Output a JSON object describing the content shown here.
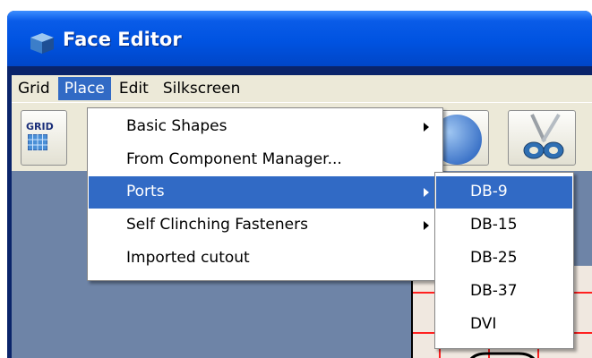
{
  "window": {
    "title": "Face Editor",
    "icon": "cube-app-icon"
  },
  "menubar": {
    "items": [
      {
        "label": "Grid"
      },
      {
        "label": "Place",
        "active": true
      },
      {
        "label": "Edit"
      },
      {
        "label": "Silkscreen"
      }
    ]
  },
  "toolbar": {
    "grid_label": "GRID",
    "buttons": [
      {
        "name": "grid-button",
        "icon": "grid-icon"
      },
      {
        "name": "circle-shape-button",
        "icon": "circle-icon"
      },
      {
        "name": "cut-button",
        "icon": "scissors-icon"
      }
    ]
  },
  "place_menu": {
    "items": [
      {
        "label": "Basic Shapes",
        "submenu": true
      },
      {
        "label": "From Component Manager...",
        "submenu": false
      },
      {
        "label": "Ports",
        "submenu": true,
        "highlighted": true
      },
      {
        "label": "Self Clinching Fasteners",
        "submenu": true
      },
      {
        "label": "Imported cutout",
        "submenu": false
      }
    ]
  },
  "ports_menu": {
    "items": [
      {
        "label": "DB-9",
        "highlighted": true
      },
      {
        "label": "DB-15"
      },
      {
        "label": "DB-25"
      },
      {
        "label": "DB-37"
      },
      {
        "label": "DVI"
      }
    ]
  },
  "colors": {
    "menu_highlight": "#316ac5",
    "titlebar": "#0053e1",
    "workspace": "#6e84a7",
    "canvas_grid": "#ff0000"
  }
}
